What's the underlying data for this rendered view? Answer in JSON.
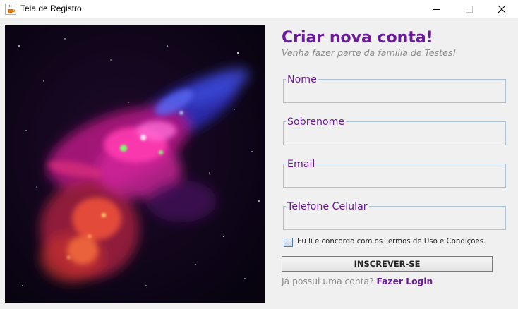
{
  "window": {
    "title": "Tela de Registro"
  },
  "form": {
    "heading": "Criar nova conta!",
    "subheading": "Venha fazer parte da família de Testes!",
    "fields": [
      {
        "label": "Nome",
        "value": ""
      },
      {
        "label": "Sobrenome",
        "value": ""
      },
      {
        "label": "Email",
        "value": ""
      },
      {
        "label": "Telefone Celular",
        "value": ""
      }
    ],
    "terms_checked": false,
    "terms_label": "Eu li e concordo com os Termos de Uso e Condições.",
    "submit_label": "INSCREVER-SE",
    "login_prompt": "Já possui uma conta?",
    "login_link": "Fazer Login"
  },
  "colors": {
    "accent": "#6a1b9a",
    "muted_text": "#8c8c8c",
    "field_border": "#a9c3dc",
    "background": "#f0f0f0"
  },
  "icons": {
    "app": "java-coffee-icon",
    "minimize": "minimize-icon",
    "maximize": "maximize-icon",
    "close": "close-icon"
  }
}
